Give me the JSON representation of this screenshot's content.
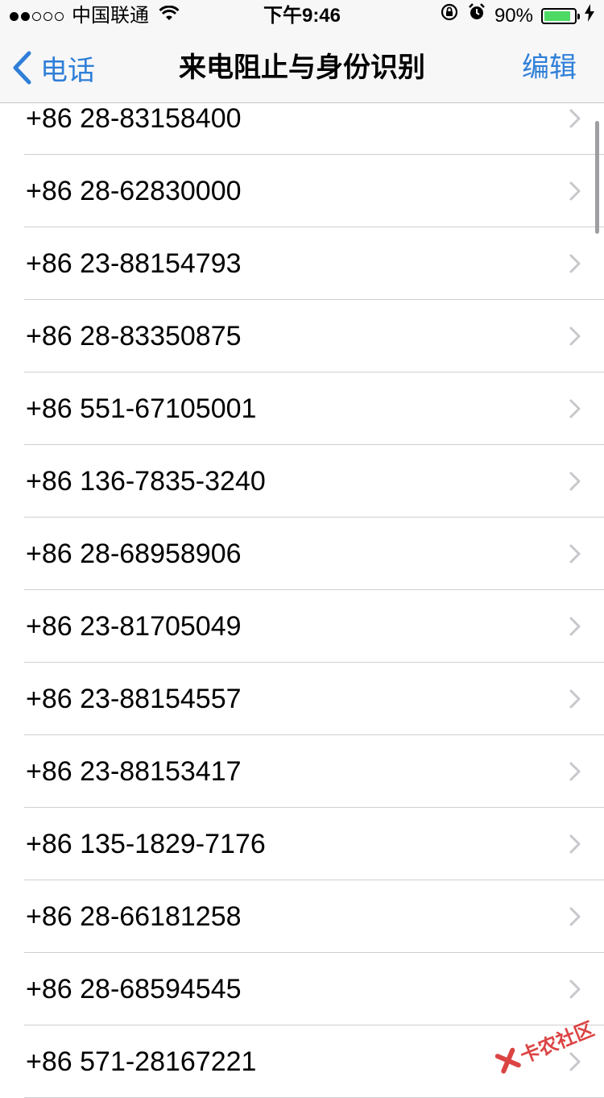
{
  "status_bar": {
    "carrier": "中国联通",
    "time": "下午9:46",
    "battery_percent_label": "90%",
    "battery_level": 0.9
  },
  "navbar": {
    "back_label": "电话",
    "title": "来电阻止与身份识别",
    "edit_label": "编辑"
  },
  "numbers": [
    "+86 28-83158400",
    "+86 28-62830000",
    "+86 23-88154793",
    "+86 28-83350875",
    "+86 551-67105001",
    "+86 136-7835-3240",
    "+86 28-68958906",
    "+86 23-81705049",
    "+86 23-88154557",
    "+86 23-88153417",
    "+86 135-1829-7176",
    "+86 28-66181258",
    "+86 28-68594545",
    "+86 571-28167221"
  ],
  "watermark": {
    "text": "卡农社区"
  },
  "colors": {
    "accent": "#2f7fd8",
    "battery": "#4cd964",
    "watermark": "#d93030"
  }
}
